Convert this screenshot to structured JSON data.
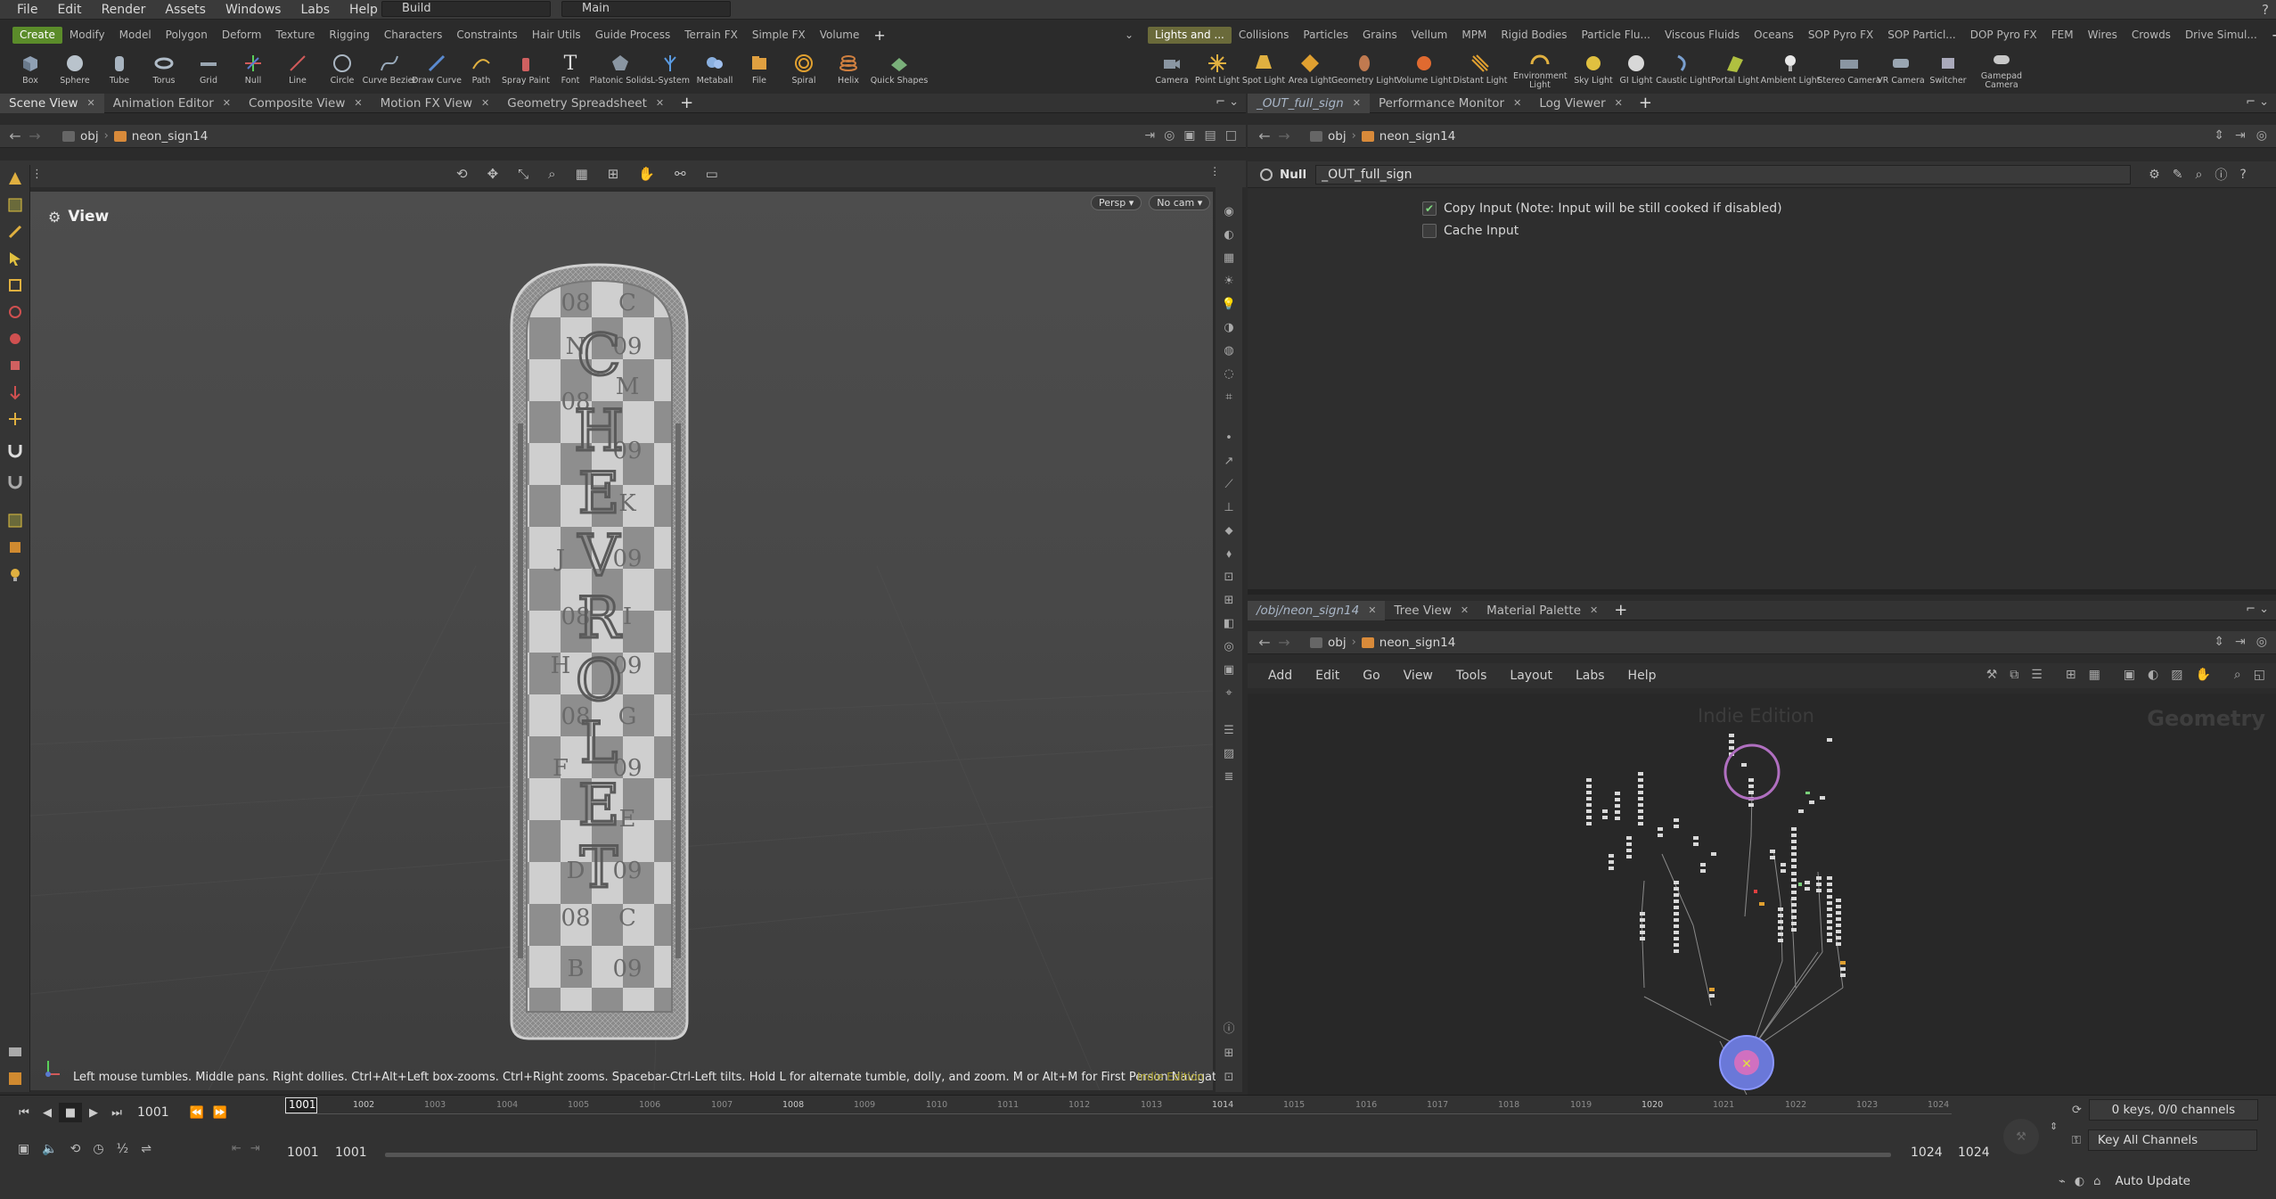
{
  "menubar": {
    "items": [
      "File",
      "Edit",
      "Render",
      "Assets",
      "Windows",
      "Labs",
      "Help"
    ],
    "desktop": "Build",
    "network": "Main"
  },
  "shelf": {
    "left_tabs": [
      "Create",
      "Modify",
      "Model",
      "Polygon",
      "Deform",
      "Texture",
      "Rigging",
      "Characters",
      "Constraints",
      "Hair Utils",
      "Guide Process",
      "Terrain FX",
      "Simple FX",
      "Volume"
    ],
    "right_tabs": [
      "Lights and ...",
      "Collisions",
      "Particles",
      "Grains",
      "Vellum",
      "MPM",
      "Rigid Bodies",
      "Particle Flu...",
      "Viscous Fluids",
      "Oceans",
      "SOP Pyro FX",
      "SOP Particl...",
      "DOP Pyro FX",
      "FEM",
      "Wires",
      "Crowds",
      "Drive Simul..."
    ],
    "left_tools": [
      {
        "label": "Box",
        "icon": "box-icon"
      },
      {
        "label": "Sphere",
        "icon": "sphere-icon"
      },
      {
        "label": "Tube",
        "icon": "tube-icon"
      },
      {
        "label": "Torus",
        "icon": "torus-icon"
      },
      {
        "label": "Grid",
        "icon": "grid-icon"
      },
      {
        "label": "Null",
        "icon": "null-icon"
      },
      {
        "label": "Line",
        "icon": "line-icon"
      },
      {
        "label": "Circle",
        "icon": "circle-icon"
      },
      {
        "label": "Curve Bezier",
        "icon": "curve-bezier-icon"
      },
      {
        "label": "Draw Curve",
        "icon": "draw-curve-icon"
      },
      {
        "label": "Path",
        "icon": "path-icon"
      },
      {
        "label": "Spray Paint",
        "icon": "spray-paint-icon"
      },
      {
        "label": "Font",
        "icon": "font-icon"
      },
      {
        "label": "Platonic Solids",
        "icon": "platonic-icon"
      },
      {
        "label": "L-System",
        "icon": "lsystem-icon"
      },
      {
        "label": "Metaball",
        "icon": "metaball-icon"
      },
      {
        "label": "File",
        "icon": "file-icon"
      },
      {
        "label": "Spiral",
        "icon": "spiral-icon"
      },
      {
        "label": "Helix",
        "icon": "helix-icon"
      },
      {
        "label": "Quick Shapes",
        "icon": "quick-shapes-icon"
      }
    ],
    "right_tools": [
      {
        "label": "Camera",
        "icon": "camera-icon"
      },
      {
        "label": "Point Light",
        "icon": "point-light-icon"
      },
      {
        "label": "Spot Light",
        "icon": "spot-light-icon"
      },
      {
        "label": "Area Light",
        "icon": "area-light-icon"
      },
      {
        "label": "Geometry Light",
        "icon": "geometry-light-icon"
      },
      {
        "label": "Volume Light",
        "icon": "volume-light-icon"
      },
      {
        "label": "Distant Light",
        "icon": "distant-light-icon"
      },
      {
        "label": "Environment Light",
        "icon": "environment-light-icon"
      },
      {
        "label": "Sky Light",
        "icon": "sky-light-icon"
      },
      {
        "label": "GI Light",
        "icon": "gi-light-icon"
      },
      {
        "label": "Caustic Light",
        "icon": "caustic-light-icon"
      },
      {
        "label": "Portal Light",
        "icon": "portal-light-icon"
      },
      {
        "label": "Ambient Light",
        "icon": "ambient-light-icon"
      },
      {
        "label": "Stereo Camera",
        "icon": "stereo-camera-icon"
      },
      {
        "label": "VR Camera",
        "icon": "vr-camera-icon"
      },
      {
        "label": "Switcher",
        "icon": "switcher-icon"
      },
      {
        "label": "Gamepad Camera",
        "icon": "gamepad-camera-icon"
      }
    ]
  },
  "left_pane": {
    "tabs": [
      "Scene View",
      "Animation Editor",
      "Composite View",
      "Motion FX View",
      "Geometry Spreadsheet"
    ],
    "path": [
      "obj",
      "neon_sign14"
    ],
    "viewport_label": "View",
    "persp": "Persp",
    "cam": "No cam",
    "hint": "Left mouse tumbles. Middle pans. Right dollies. Ctrl+Alt+Left box-zooms. Ctrl+Right zooms. Spacebar-Ctrl-Left tilts. Hold L for alternate tumble, dolly, and zoom. M or Alt+M for First Person Navigation.",
    "indie": "Indie Edition",
    "sign_letters": [
      "C",
      "H",
      "E",
      "V",
      "R",
      "O",
      "L",
      "E",
      "T"
    ],
    "sign_tiles": [
      "08",
      "C",
      "N",
      "09",
      "M",
      "08",
      "09",
      "K",
      "I",
      "J",
      "09",
      "08",
      "I",
      "H",
      "09",
      "08",
      "G",
      "F",
      "09",
      "E",
      "D",
      "09",
      "08",
      "C",
      "B",
      "09"
    ]
  },
  "param_pane": {
    "tabs": [
      "_OUT_full_sign",
      "Performance Monitor",
      "Log Viewer"
    ],
    "path": [
      "obj",
      "neon_sign14"
    ],
    "node_type": "Null",
    "node_name": "_OUT_full_sign",
    "params": [
      {
        "label": "Copy Input (Note: Input will be still cooked if disabled)",
        "checked": true
      },
      {
        "label": "Cache Input",
        "checked": false
      }
    ]
  },
  "network_pane": {
    "tabs": [
      "/obj/neon_sign14",
      "Tree View",
      "Material Palette"
    ],
    "path": [
      "obj",
      "neon_sign14"
    ],
    "menu": [
      "Add",
      "Edit",
      "Go",
      "View",
      "Tools",
      "Layout",
      "Labs",
      "Help"
    ],
    "watermark": "Indie Edition",
    "context": "Geometry"
  },
  "timeline": {
    "current_frame": "1001",
    "frame_field": "1001",
    "range_start": "1001",
    "range_start2": "1001",
    "range_end": "1024",
    "range_end2": "1024",
    "ticks": [
      "1002",
      "1003",
      "1004",
      "1005",
      "1006",
      "1007",
      "1008",
      "1009",
      "1010",
      "1011",
      "1012",
      "1013",
      "1014",
      "1015",
      "1016",
      "1017",
      "1018",
      "1019",
      "1020",
      "1021",
      "1022",
      "1023",
      "1024"
    ],
    "keys_info": "0 keys, 0/0 channels",
    "key_all": "Key All Channels",
    "auto_update": "Auto Update"
  },
  "colors": {
    "accent_green": "#5b8c2a",
    "indie_yellow": "#a89d2a",
    "node_selected": "#b06fc0",
    "output_node": "#6a78d8"
  }
}
